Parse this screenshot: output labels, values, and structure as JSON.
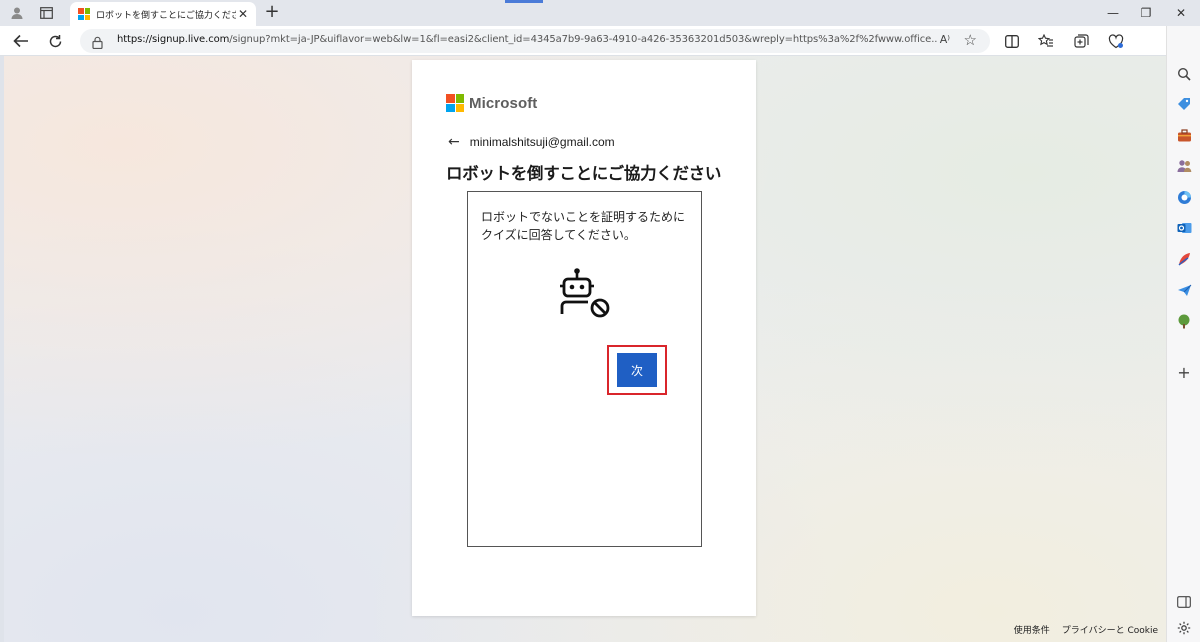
{
  "tab": {
    "title": "ロボットを倒すことにご協力ください",
    "close_glyph": "✕"
  },
  "new_tab_glyph": "+",
  "window_controls": {
    "minimize": "—",
    "restore": "❐",
    "close": "✕"
  },
  "address": {
    "host": "https://signup.live.com",
    "path": "/signup?mkt=ja-JP&uiflavor=web&lw=1&fl=easi2&client_id=4345a7b9-9a63-4910-a426-35363201d503&wreply=https%3a%2f%2fwww.office...",
    "read_aloud": "A⁾"
  },
  "card": {
    "brand": "Microsoft",
    "back_arrow": "←",
    "email": "minimalshitsuji@gmail.com",
    "heading": "ロボットを倒すことにご協力ください",
    "challenge": {
      "message": "ロボットでないことを証明するために クイズに回答してください。",
      "next_label": "次"
    }
  },
  "footer": {
    "terms": "使用条件",
    "privacy": "プライバシーと Cookie"
  },
  "colors": {
    "ms_red": "#f25022",
    "ms_green": "#7fba00",
    "ms_blue": "#00a4ef",
    "ms_yellow": "#ffb900",
    "button_blue": "#1f5fc4",
    "highlight_red": "#d9252b"
  },
  "sidebar_icons": [
    "search-icon",
    "tag-icon",
    "briefcase-icon",
    "people-icon",
    "office-icon",
    "outlook-icon",
    "feather-icon",
    "send-icon",
    "tree-icon",
    "add-icon",
    "expand-icon",
    "settings-icon"
  ]
}
